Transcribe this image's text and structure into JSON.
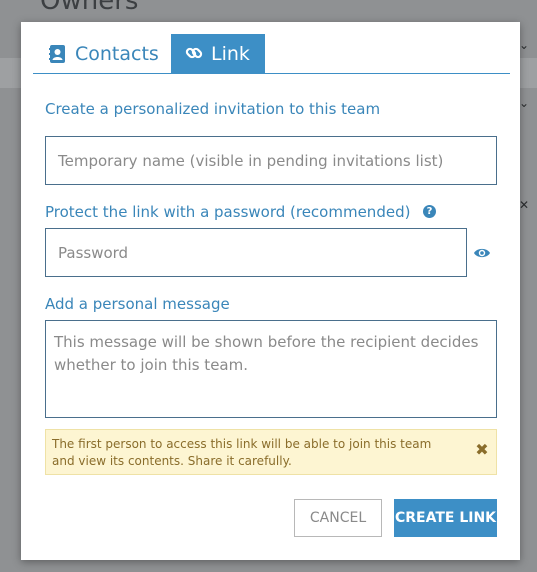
{
  "background": {
    "page_title": "Owners"
  },
  "tabs": [
    {
      "label": "Contacts",
      "icon": "address-book-icon",
      "active": false
    },
    {
      "label": "Link",
      "icon": "link-icon",
      "active": true
    }
  ],
  "form": {
    "invite_heading": "Create a personalized invitation to this team",
    "temp_name_placeholder": "Temporary name (visible in pending invitations list)",
    "password_label": "Protect the link with a password (recommended)",
    "password_placeholder": "Password",
    "message_label": "Add a personal message",
    "message_placeholder": "This message will be shown before the recipient decides whether to join this team."
  },
  "warning": {
    "text": "The first person to access this link will be able to join this team and view its contents. Share it carefully."
  },
  "buttons": {
    "cancel": "CANCEL",
    "create": "CREATE LINK"
  },
  "colors": {
    "accent": "#3d8fc6",
    "warning_bg": "#fdf5d2",
    "warning_text": "#8a6d2b"
  }
}
